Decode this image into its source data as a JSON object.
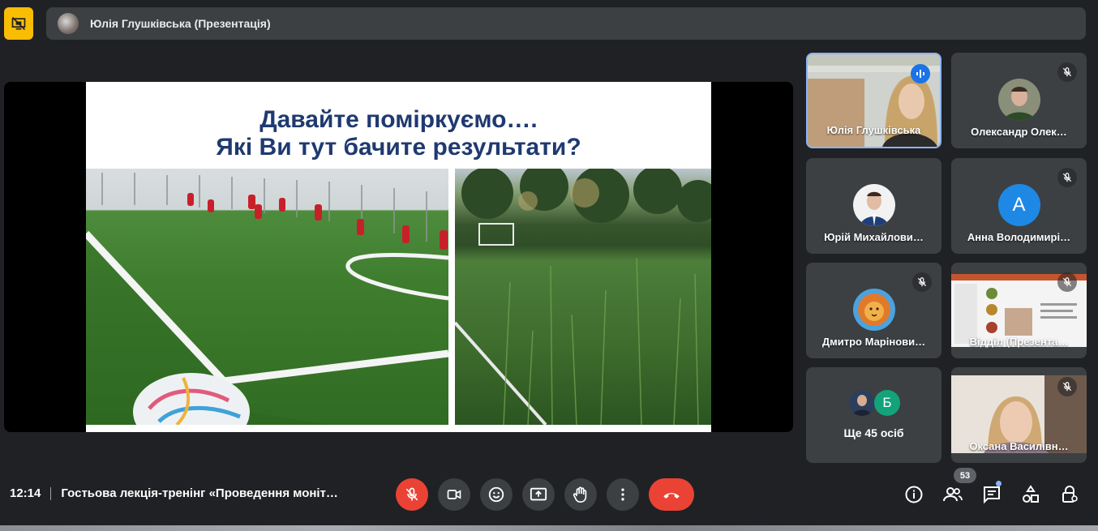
{
  "header": {
    "presenter_label": "Юлія Глушківська (Презентація)",
    "present_icon": "presentation-off-icon"
  },
  "slide": {
    "title_line1": "Давайте поміркуємо….",
    "title_line2": "Які Ви тут бачите результати?"
  },
  "participants": [
    {
      "name": "Юлія Глушківська",
      "state": "speaking"
    },
    {
      "name": "Олександр Олек…",
      "state": "muted"
    },
    {
      "name": "Юрій Михайлови…",
      "state": "unmuted"
    },
    {
      "name": "Анна Володимирі…",
      "state": "muted",
      "avatar_letter": "A"
    },
    {
      "name": "Дмитро Марінови…",
      "state": "muted"
    },
    {
      "name": "Відділ (Презента…",
      "state": "muted"
    },
    {
      "name": "Оксана Василівн…",
      "state": "muted"
    }
  ],
  "more": {
    "label": "Ще 45 осіб",
    "letter": "Б"
  },
  "bottom": {
    "time": "12:14",
    "meeting_title": "Гостьова лекція-тренінг «Проведення моніт…",
    "people_count": "53"
  },
  "colors": {
    "background": "#202124",
    "tile": "#3c4043",
    "danger": "#ea4335",
    "accent": "#8ab4f8",
    "slide_title": "#1f3a70"
  }
}
